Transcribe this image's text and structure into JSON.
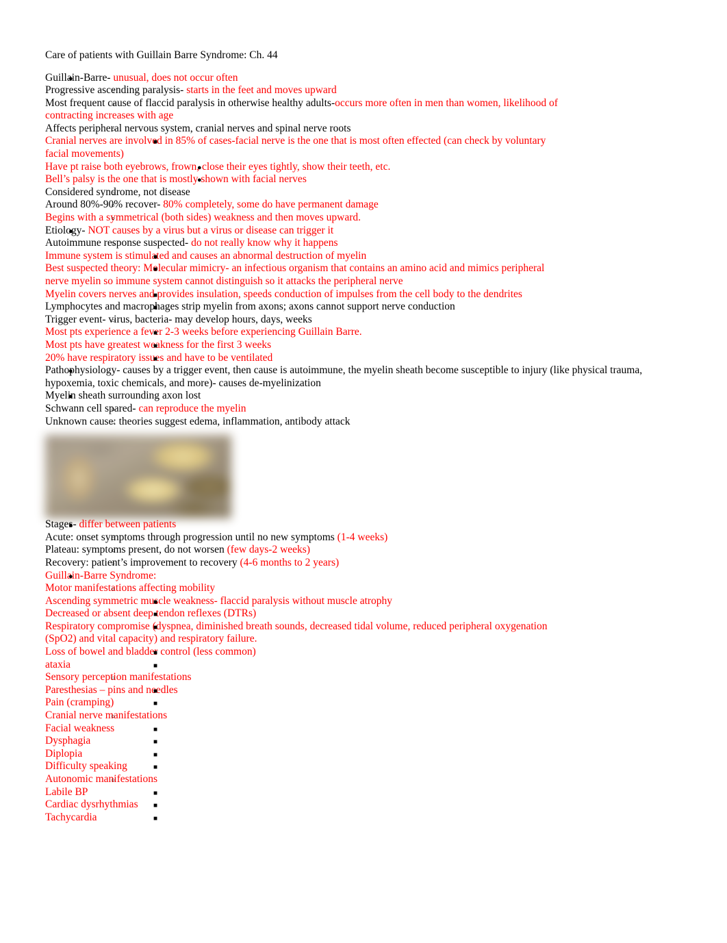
{
  "document": {
    "title": "Care of patients with Guillain Barre Syndrome: Ch. 44",
    "colors": {
      "body_text": "#000000",
      "highlight_text": "#ff0000"
    },
    "bullets": {
      "level1": "filled-disc",
      "level2": "open-circle",
      "level3": "filled-square",
      "level4": "filled-disc"
    }
  },
  "outline": {
    "i1": {
      "black": "Guillain-Barre- ",
      "red": "unusual, does not occur often"
    },
    "i2": {
      "black": "Progressive ascending paralysis- ",
      "red": "starts in the feet and moves upward"
    },
    "i3": {
      "black": "Most frequent cause of flaccid paralysis in otherwise healthy adults-",
      "red": "occurs more often in men than women, likelihood of contracting increases with age"
    },
    "i4": {
      "black": "Affects peripheral nervous system, cranial nerves and spinal nerve roots"
    },
    "i5": {
      "red": "Cranial nerves are involved in 85% of cases-facial nerve is the one that is most often effected (can check by voluntary facial movements)"
    },
    "i6": {
      "red": "Have pt raise both eyebrows, frown, close their eyes tightly, show their teeth, etc."
    },
    "i7": {
      "red": "Bell’s palsy is the one that is mostly shown with facial nerves"
    },
    "i8": {
      "black": "Considered syndrome, not disease"
    },
    "i9": {
      "black": "Around 80%-90% recover- ",
      "red": "80% completely, some do have permanent damage"
    },
    "i10": {
      "red": "Begins with a symmetrical (both sides) weakness and then moves upward."
    },
    "i11": {
      "black": "Etiology- ",
      "red": "NOT causes by a virus but a virus or disease can trigger it"
    },
    "i12": {
      "black": "Autoimmune response suspected- ",
      "red": "do not really know why it happens"
    },
    "i13": {
      "red": "Immune system is stimulated and causes an abnormal destruction of myelin"
    },
    "i14": {
      "red": "Best suspected theory: Molecular mimicry- an infectious organism that contains an amino acid and mimics peripheral nerve myelin so immune system cannot distinguish so it attacks the peripheral nerve"
    },
    "i15": {
      "red": "Myelin covers nerves and provides insulation, speeds conduction of impulses from the cell body to the dendrites"
    },
    "i16": {
      "black": "Lymphocytes and macrophages strip myelin from axons; axons cannot support nerve conduction"
    },
    "i17": {
      "black": "Trigger event- virus, bacteria- may develop hours, days, weeks"
    },
    "i18": {
      "red": "Most pts experience a fever 2-3 weeks before experiencing Guillain Barre."
    },
    "i19": {
      "red": "Most pts have greatest weakness for the first 3 weeks"
    },
    "i20": {
      "red": "20% have respiratory issues and have to be ventilated"
    },
    "i21": {
      "black": "Pathophysiology- causes by a trigger event, then cause is autoimmune, the myelin sheath become susceptible to injury (like physical trauma, hypoxemia, toxic chemicals, and more)- causes de-myelinization"
    },
    "i22": {
      "black": "Myelin sheath surrounding axon lost"
    },
    "i23": {
      "black": "Schwann cell spared- ",
      "red": "can reproduce the myelin"
    },
    "i24": {
      "black": "Unknown cause: theories suggest edema, inflammation, antibody attack"
    },
    "i25": {
      "black": "Stages- ",
      "red": "differ between patients"
    },
    "i26": {
      "black": "Acute: onset symptoms through progression until no new symptoms ",
      "red": "(1-4 weeks)"
    },
    "i27": {
      "black": "Plateau: symptoms present, do not worsen ",
      "red": "(few days-2 weeks)"
    },
    "i28": {
      "black": "Recovery: patient’s improvement to recovery ",
      "red": "(4-6 months to 2 years)"
    },
    "i29": {
      "red": "Guillain-Barre Syndrome:"
    },
    "i30": {
      "red": "Motor manifestations affecting mobility"
    },
    "i31": {
      "red": "Ascending symmetric muscle weakness- flaccid paralysis without muscle atrophy"
    },
    "i32": {
      "red": "Decreased or absent deep tendon reflexes (DTRs)"
    },
    "i33": {
      "red": "Respiratory compromise (dyspnea, diminished breath sounds, decreased tidal volume, reduced peripheral oxygenation (SpO2) and vital capacity) and respiratory failure."
    },
    "i34": {
      "red": "Loss of bowel and bladder control (less common)"
    },
    "i35": {
      "red": "ataxia"
    },
    "i36": {
      "red": "Sensory perception manifestations"
    },
    "i37": {
      "red": "Paresthesias – pins and needles"
    },
    "i38": {
      "red": "Pain (cramping)"
    },
    "i39": {
      "red": "Cranial nerve manifestations"
    },
    "i40": {
      "red": "Facial weakness"
    },
    "i41": {
      "red": "Dysphagia"
    },
    "i42": {
      "red": "Diplopia"
    },
    "i43": {
      "red": "Difficulty speaking"
    },
    "i44": {
      "red": "Autonomic manifestations"
    },
    "i45": {
      "red": "Labile BP"
    },
    "i46": {
      "red": "Cardiac dysrhythmias"
    },
    "i47": {
      "red": "Tachycardia"
    }
  }
}
